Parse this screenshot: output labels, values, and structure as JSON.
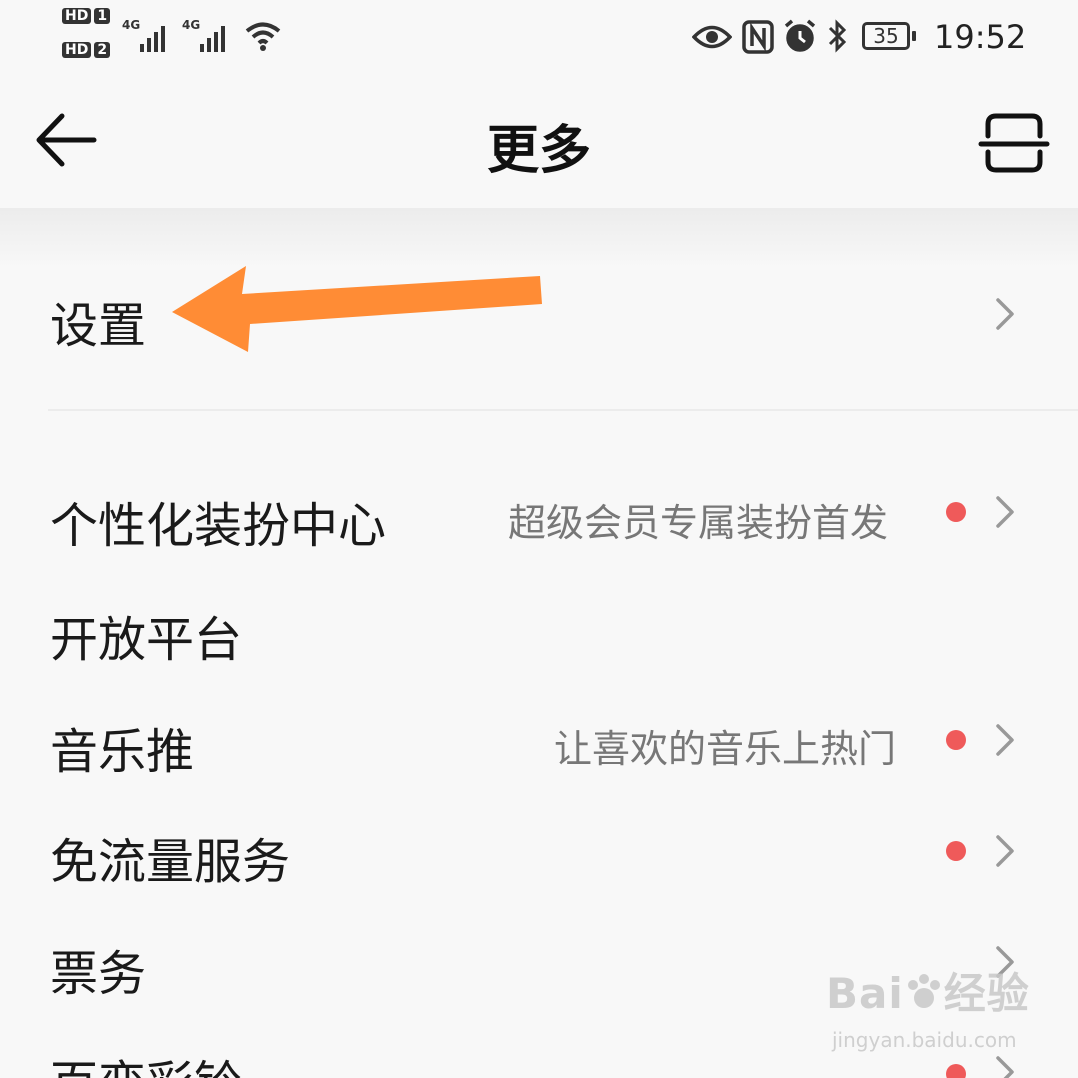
{
  "status_bar": {
    "hd1": "HD",
    "hd1_num": "1",
    "hd2": "HD",
    "hd2_num": "2",
    "sig1": "4G",
    "sig2": "4G",
    "battery": "35",
    "time": "19:52",
    "icons": [
      "eye-icon",
      "nfc-icon",
      "alarm-icon",
      "bluetooth-icon",
      "battery-icon",
      "wifi-icon"
    ]
  },
  "header": {
    "title": "更多",
    "back_icon": "arrow-left-icon",
    "right_icon": "scan-icon"
  },
  "settings_row": {
    "label": "设置"
  },
  "menu": {
    "items": [
      {
        "label": "个性化装扮中心",
        "subtitle": "超级会员专属装扮首发",
        "dot": true
      },
      {
        "label": "开放平台",
        "subtitle": "",
        "dot": false
      },
      {
        "label": "音乐推",
        "subtitle": "让喜欢的音乐上热门",
        "dot": true
      },
      {
        "label": "免流量服务",
        "subtitle": "",
        "dot": true
      },
      {
        "label": "票务",
        "subtitle": "",
        "dot": false
      },
      {
        "label": "百变彩铃",
        "subtitle": "",
        "dot": true
      }
    ]
  },
  "annotation": {
    "color": "#ff8c35"
  },
  "colors": {
    "dot": "#ef5a5a",
    "background": "#f8f8f8"
  },
  "watermark": {
    "main": "Bai",
    "main_cn": "经验",
    "sub": "jingyan.baidu.com"
  }
}
